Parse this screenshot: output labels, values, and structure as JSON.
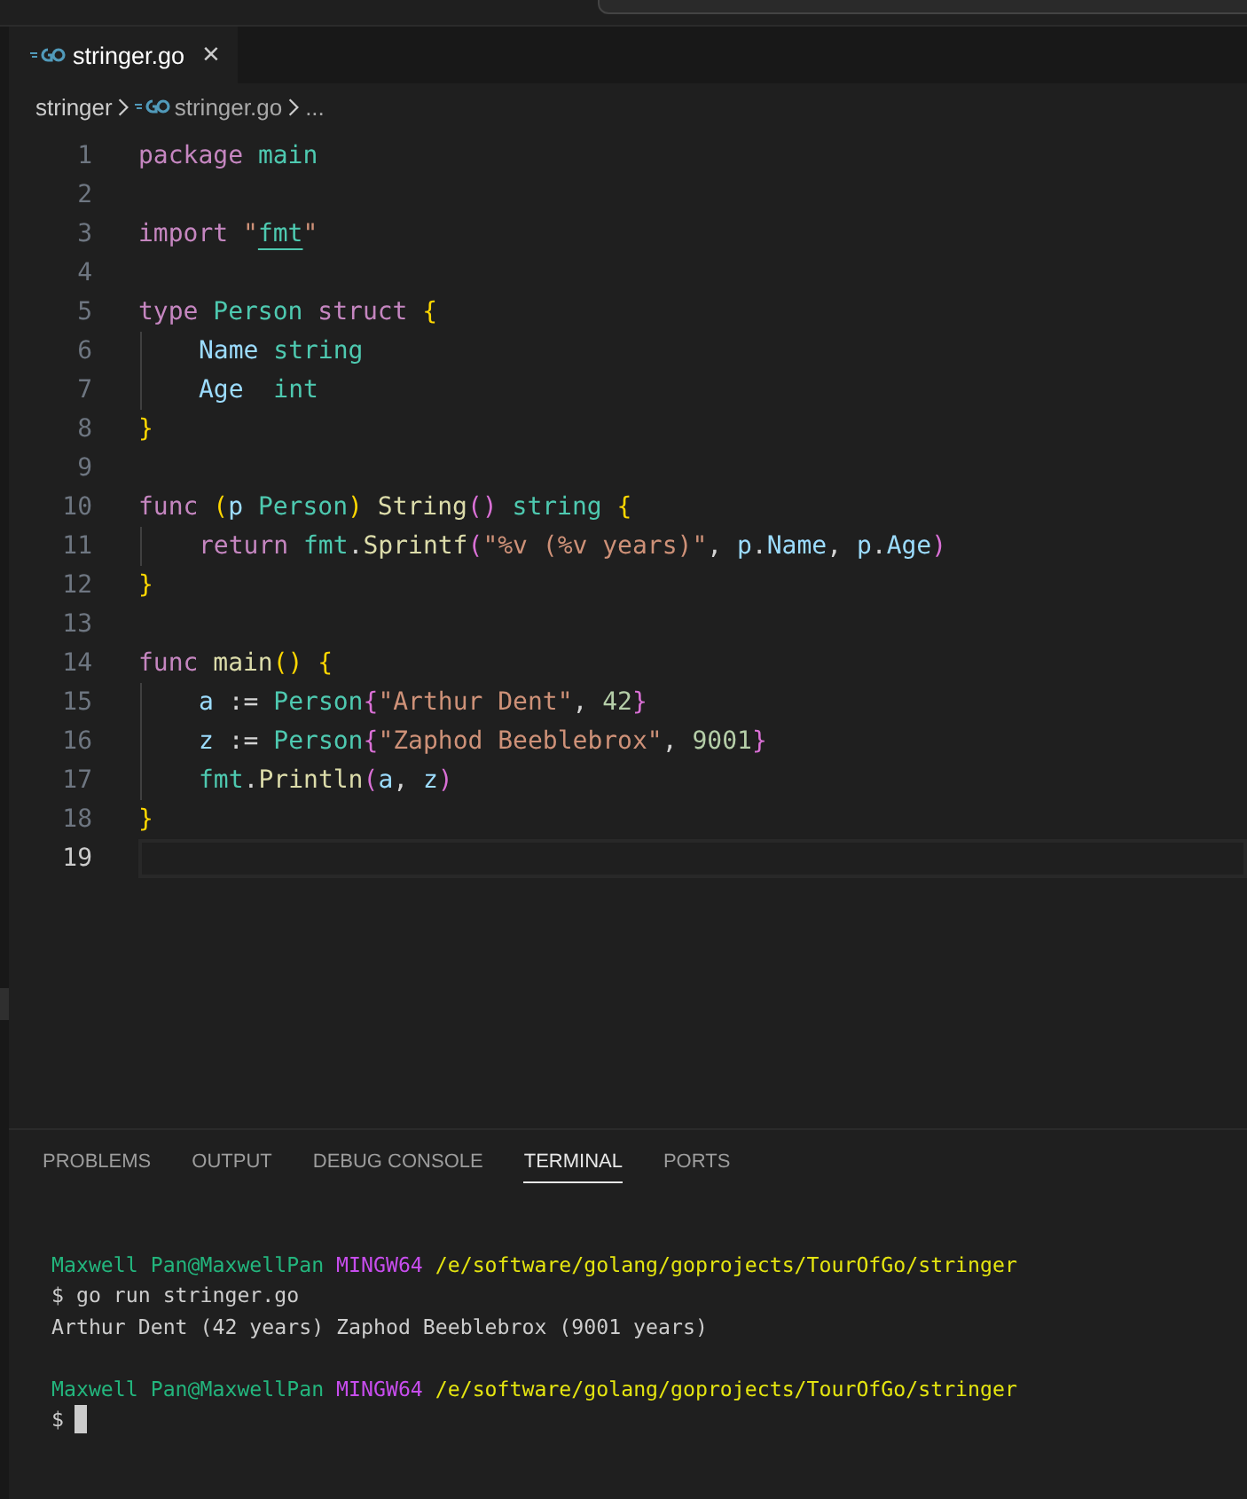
{
  "tabs": [
    {
      "label": "stringer.go",
      "selected": true,
      "close": "×"
    }
  ],
  "breadcrumb": [
    {
      "label": "stringer",
      "icon": false
    },
    {
      "label": "stringer.go",
      "icon": true
    },
    {
      "label": "...",
      "icon": false
    }
  ],
  "code_lines": [
    {
      "number": "1",
      "current": false,
      "guide": false,
      "tokens": [
        {
          "kind": "kw",
          "text": "package"
        },
        {
          "kind": "type",
          "text": " main"
        }
      ]
    },
    {
      "number": "2",
      "current": false,
      "guide": false
    },
    {
      "number": "3",
      "current": false,
      "guide": false,
      "tokens": [
        {
          "kind": "kw",
          "text": "import"
        },
        {
          "kind": "str",
          "text": " \""
        },
        {
          "kind": "pkg",
          "text": "fmt"
        },
        {
          "kind": "str",
          "text": "\""
        }
      ]
    },
    {
      "number": "4",
      "current": false,
      "guide": false
    },
    {
      "number": "5",
      "current": false,
      "guide": false,
      "tokens": [
        {
          "kind": "kw",
          "text": "type"
        },
        {
          "kind": "type",
          "text": " Person"
        },
        {
          "kind": "kw",
          "text": " struct"
        },
        {
          "kind": "b1",
          "text": " {"
        }
      ]
    },
    {
      "number": "6",
      "current": false,
      "guide": true,
      "tokens": [
        {
          "kind": "var",
          "text": "Name"
        },
        {
          "kind": "type",
          "text": " string"
        }
      ]
    },
    {
      "number": "7",
      "current": false,
      "guide": true,
      "tokens": [
        {
          "kind": "var",
          "text": "Age"
        },
        {
          "kind": "type",
          "text": "  int"
        }
      ]
    },
    {
      "number": "8",
      "current": false,
      "guide": false,
      "tokens": [
        {
          "kind": "b1",
          "text": "}"
        }
      ]
    },
    {
      "number": "9",
      "current": false,
      "guide": false
    },
    {
      "number": "10",
      "current": false,
      "guide": false,
      "tokens": [
        {
          "kind": "kw",
          "text": "func"
        },
        {
          "kind": "b1",
          "text": " ("
        },
        {
          "kind": "var",
          "text": "p"
        },
        {
          "kind": "type",
          "text": " Person"
        },
        {
          "kind": "b1",
          "text": ")"
        },
        {
          "kind": "fn",
          "text": " String"
        },
        {
          "kind": "b2",
          "text": "()"
        },
        {
          "kind": "type",
          "text": " string"
        },
        {
          "kind": "b1",
          "text": " {"
        }
      ]
    },
    {
      "number": "11",
      "current": false,
      "guide": true,
      "tokens": [
        {
          "kind": "kw",
          "text": "return"
        },
        {
          "kind": "type",
          "text": " fmt"
        },
        {
          "kind": "plain",
          "text": "."
        },
        {
          "kind": "fn",
          "text": "Sprintf"
        },
        {
          "kind": "b2",
          "text": "("
        },
        {
          "kind": "str",
          "text": "\"%v (%v years)\""
        },
        {
          "kind": "plain",
          "text": ","
        },
        {
          "kind": "var",
          "text": " p"
        },
        {
          "kind": "plain",
          "text": "."
        },
        {
          "kind": "var",
          "text": "Name"
        },
        {
          "kind": "plain",
          "text": ","
        },
        {
          "kind": "var",
          "text": " p"
        },
        {
          "kind": "plain",
          "text": "."
        },
        {
          "kind": "var",
          "text": "Age"
        },
        {
          "kind": "b2",
          "text": ")"
        }
      ]
    },
    {
      "number": "12",
      "current": false,
      "guide": false,
      "tokens": [
        {
          "kind": "b1",
          "text": "}"
        }
      ]
    },
    {
      "number": "13",
      "current": false,
      "guide": false
    },
    {
      "number": "14",
      "current": false,
      "guide": false,
      "tokens": [
        {
          "kind": "kw",
          "text": "func"
        },
        {
          "kind": "fn",
          "text": " main"
        },
        {
          "kind": "b1",
          "text": "()"
        },
        {
          "kind": "b1",
          "text": " {"
        }
      ]
    },
    {
      "number": "15",
      "current": false,
      "guide": true,
      "tokens": [
        {
          "kind": "var",
          "text": "a"
        },
        {
          "kind": "plain",
          "text": " :="
        },
        {
          "kind": "type",
          "text": " Person"
        },
        {
          "kind": "b2",
          "text": "{"
        },
        {
          "kind": "str",
          "text": "\"Arthur Dent\""
        },
        {
          "kind": "plain",
          "text": ","
        },
        {
          "kind": "num",
          "text": " 42"
        },
        {
          "kind": "b2",
          "text": "}"
        }
      ]
    },
    {
      "number": "16",
      "current": false,
      "guide": true,
      "tokens": [
        {
          "kind": "var",
          "text": "z"
        },
        {
          "kind": "plain",
          "text": " :="
        },
        {
          "kind": "type",
          "text": " Person"
        },
        {
          "kind": "b2",
          "text": "{"
        },
        {
          "kind": "str",
          "text": "\"Zaphod Beeblebrox\""
        },
        {
          "kind": "plain",
          "text": ","
        },
        {
          "kind": "num",
          "text": " 9001"
        },
        {
          "kind": "b2",
          "text": "}"
        }
      ]
    },
    {
      "number": "17",
      "current": false,
      "guide": true,
      "tokens": [
        {
          "kind": "type",
          "text": "fmt"
        },
        {
          "kind": "plain",
          "text": "."
        },
        {
          "kind": "fn",
          "text": "Println"
        },
        {
          "kind": "b2",
          "text": "("
        },
        {
          "kind": "var",
          "text": "a"
        },
        {
          "kind": "plain",
          "text": ","
        },
        {
          "kind": "var",
          "text": " z"
        },
        {
          "kind": "b2",
          "text": ")"
        }
      ]
    },
    {
      "number": "18",
      "current": false,
      "guide": false,
      "tokens": [
        {
          "kind": "b1",
          "text": "}"
        }
      ]
    },
    {
      "number": "19",
      "current": true,
      "guide": false
    }
  ],
  "panel_tabs": [
    {
      "label": "PROBLEMS",
      "selected": false
    },
    {
      "label": "OUTPUT",
      "selected": false
    },
    {
      "label": "DEBUG CONSOLE",
      "selected": false
    },
    {
      "label": "TERMINAL",
      "selected": true
    },
    {
      "label": "PORTS",
      "selected": false
    }
  ],
  "terminal_lines": [
    {
      "blank_before": true,
      "segments": [
        {
          "kind": "user",
          "text": "Maxwell Pan@MaxwellPan"
        },
        {
          "kind": "system",
          "text": " MINGW64"
        },
        {
          "kind": "path",
          "text": " /e/software/golang/goprojects/TourOfGo/stringer"
        }
      ]
    },
    {
      "blank_before": false,
      "segments": [
        {
          "kind": "plain",
          "text": "$ go run stringer.go"
        }
      ]
    },
    {
      "blank_before": false,
      "segments": [
        {
          "kind": "plain",
          "text": "Arthur Dent (42 years) Zaphod Beeblebrox (9001 years)"
        }
      ]
    },
    {
      "blank_before": true,
      "segments": [
        {
          "kind": "user",
          "text": "Maxwell Pan@MaxwellPan"
        },
        {
          "kind": "system",
          "text": " MINGW64"
        },
        {
          "kind": "path",
          "text": " /e/software/golang/goprojects/TourOfGo/stringer"
        }
      ]
    },
    {
      "blank_before": false,
      "segments": [
        {
          "kind": "plain",
          "text": "$"
        }
      ],
      "cursor": true
    }
  ]
}
